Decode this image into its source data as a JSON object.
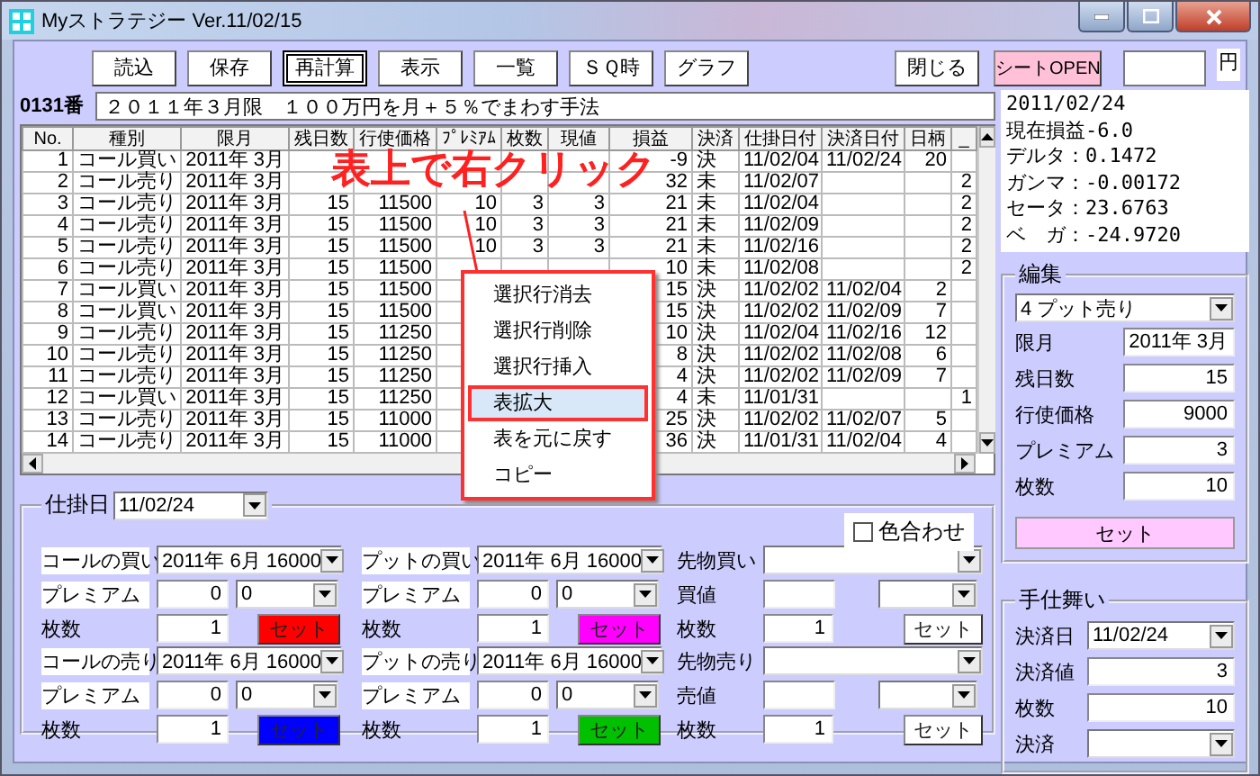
{
  "window": {
    "title": "Myストラテジー Ver.11/02/15"
  },
  "toolbar": {
    "buttons": [
      {
        "label": "読込",
        "focused": false
      },
      {
        "label": "保存",
        "focused": false
      },
      {
        "label": "再計算",
        "focused": true
      },
      {
        "label": "表示",
        "focused": false
      },
      {
        "label": "一覧",
        "focused": false
      },
      {
        "label": "ＳＱ時",
        "focused": false
      },
      {
        "label": "グラフ",
        "focused": false
      }
    ],
    "close_button": "閉じる",
    "sheet_button": "シートOPEN",
    "amount_unit": "円"
  },
  "strategy": {
    "number": "0131番",
    "description": "２０１１年３月限　１００万円を月＋５％でまわす手法"
  },
  "summary": [
    "2011/02/24",
    "現在損益-6.0",
    "デルタ：0.1472",
    "ガンマ：-0.00172",
    "セータ：23.6763",
    "ベ　ガ：-24.9720"
  ],
  "table": {
    "columns": [
      "No.",
      "種別",
      "限月",
      "残日数",
      "行使価格",
      "ﾌﾟﾚﾐｱﾑ",
      "枚数",
      "現値",
      "損益",
      "決済",
      "仕掛日付",
      "決済日付",
      "日柄",
      "_"
    ],
    "rows": [
      {
        "cells": [
          "1",
          "コール買い",
          "2011年 3月",
          null,
          null,
          null,
          null,
          null,
          "-9",
          "決",
          "11/02/04",
          "11/02/24",
          "20",
          null
        ]
      },
      {
        "cells": [
          "2",
          "コール売り",
          "2011年 3月",
          null,
          null,
          null,
          null,
          null,
          "32",
          "未",
          "11/02/07",
          null,
          null,
          "2"
        ]
      },
      {
        "cells": [
          "3",
          "コール売り",
          "2011年 3月",
          "15",
          "11500",
          "10",
          "3",
          "3",
          "21",
          "未",
          "11/02/04",
          null,
          null,
          "2"
        ]
      },
      {
        "cells": [
          "4",
          "コール売り",
          "2011年 3月",
          "15",
          "11500",
          "10",
          "3",
          "3",
          "21",
          "未",
          "11/02/09",
          null,
          null,
          "2"
        ]
      },
      {
        "cells": [
          "5",
          "コール売り",
          "2011年 3月",
          "15",
          "11500",
          "10",
          "3",
          "3",
          "21",
          "未",
          "11/02/16",
          null,
          null,
          "2"
        ]
      },
      {
        "cells": [
          "6",
          "コール売り",
          "2011年 3月",
          "15",
          "11500",
          null,
          null,
          null,
          "10",
          "未",
          "11/02/08",
          null,
          null,
          "2"
        ]
      },
      {
        "cells": [
          "7",
          "コール買い",
          "2011年 3月",
          "15",
          "11500",
          null,
          null,
          null,
          "15",
          "決",
          "11/02/02",
          "11/02/04",
          "2",
          null
        ]
      },
      {
        "cells": [
          "8",
          "コール買い",
          "2011年 3月",
          "15",
          "11500",
          null,
          null,
          null,
          "15",
          "決",
          "11/02/02",
          "11/02/09",
          "7",
          null
        ]
      },
      {
        "cells": [
          "9",
          "コール売り",
          "2011年 3月",
          "15",
          "11250",
          null,
          null,
          null,
          "10",
          "決",
          "11/02/04",
          "11/02/16",
          "12",
          null
        ]
      },
      {
        "cells": [
          "10",
          "コール売り",
          "2011年 3月",
          "15",
          "11250",
          null,
          null,
          null,
          "8",
          "決",
          "11/02/02",
          "11/02/08",
          "6",
          null
        ]
      },
      {
        "cells": [
          "11",
          "コール売り",
          "2011年 3月",
          "15",
          "11250",
          null,
          null,
          null,
          "4",
          "決",
          "11/02/02",
          "11/02/09",
          "7",
          null
        ]
      },
      {
        "cells": [
          "12",
          "コール買い",
          "2011年 3月",
          "15",
          "11250",
          null,
          null,
          null,
          "4",
          "未",
          "11/01/31",
          null,
          null,
          "1"
        ]
      },
      {
        "cells": [
          "13",
          "コール売り",
          "2011年 3月",
          "15",
          "11000",
          null,
          null,
          null,
          "25",
          "決",
          "11/02/02",
          "11/02/07",
          "5",
          null
        ]
      },
      {
        "cells": [
          "14",
          "コール売り",
          "2011年 3月",
          "15",
          "11000",
          null,
          null,
          null,
          "36",
          "決",
          "11/01/31",
          "11/02/04",
          "4",
          null
        ]
      }
    ]
  },
  "context_menu": {
    "items": [
      {
        "label": "選択行消去",
        "selected": false
      },
      {
        "label": "選択行削除",
        "selected": false
      },
      {
        "label": "選択行挿入",
        "selected": false
      },
      {
        "label": "表拡大",
        "selected": true
      },
      {
        "label": "表を元に戻す",
        "selected": false
      },
      {
        "label": "コピー",
        "selected": false
      }
    ]
  },
  "annotation": {
    "text": "表上で右クリック"
  },
  "edit_panel": {
    "title": "編集",
    "type_select": "4 プット売り",
    "fields": [
      {
        "label": "限月",
        "value": "2011年 3月"
      },
      {
        "label": "残日数",
        "value": "15"
      },
      {
        "label": "行使価格",
        "value": "9000"
      },
      {
        "label": "プレミアム",
        "value": "3"
      },
      {
        "label": "枚数",
        "value": "10"
      }
    ],
    "set_button": "セット"
  },
  "entry_panel": {
    "title": "仕掛日",
    "date": "11/02/24",
    "color_match": {
      "label": "色合わせ",
      "checked": false
    },
    "sections": [
      {
        "kind": "option",
        "title": "コールの買い",
        "contract": "2011年 6月 16000",
        "premium_label": "プレミアム",
        "premium": "0",
        "premium_select": "0",
        "qty_label": "枚数",
        "qty": "1",
        "set_button": "セット",
        "color": "#ff0000"
      },
      {
        "kind": "option",
        "title": "プットの買い",
        "contract": "2011年 6月 16000",
        "premium_label": "プレミアム",
        "premium": "0",
        "premium_select": "0",
        "qty_label": "枚数",
        "qty": "1",
        "set_button": "セット",
        "color": "#ff00ff"
      },
      {
        "kind": "futures",
        "title": "先物買い",
        "price_label": "買値",
        "qty_label": "枚数",
        "qty": "1",
        "set_button": "セット"
      },
      {
        "kind": "option",
        "title": "コールの売り",
        "contract": "2011年 6月 16000",
        "premium_label": "プレミアム",
        "premium": "0",
        "premium_select": "0",
        "qty_label": "枚数",
        "qty": "1",
        "set_button": "セット",
        "color": "#0000ff"
      },
      {
        "kind": "option",
        "title": "プットの売り",
        "contract": "2011年 6月 16000",
        "premium_label": "プレミアム",
        "premium": "0",
        "premium_select": "0",
        "qty_label": "枚数",
        "qty": "1",
        "set_button": "セット",
        "color": "#00c000"
      },
      {
        "kind": "futures",
        "title": "先物売り",
        "price_label": "売値",
        "qty_label": "枚数",
        "qty": "1",
        "set_button": "セット"
      }
    ]
  },
  "close_panel": {
    "title": "手仕舞い",
    "fields": [
      {
        "kind": "select",
        "label": "決済日",
        "value": "11/02/24"
      },
      {
        "kind": "text",
        "label": "決済値",
        "value": "3"
      },
      {
        "kind": "text",
        "label": "枚数",
        "value": "10"
      },
      {
        "kind": "select",
        "label": "決済"
      }
    ]
  }
}
